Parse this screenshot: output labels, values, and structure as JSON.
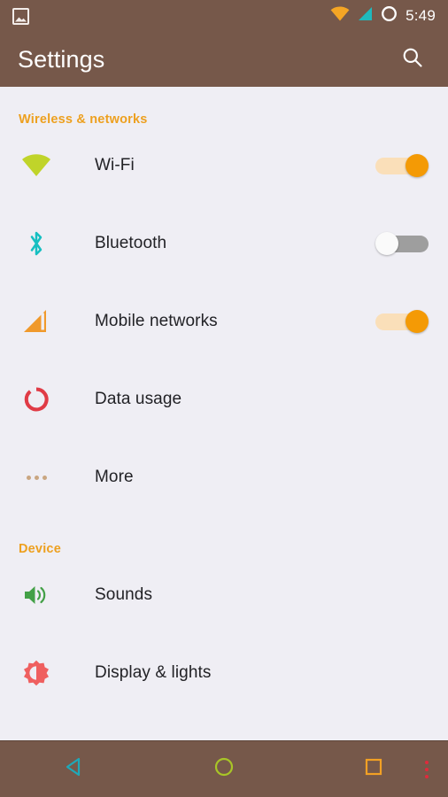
{
  "status_bar": {
    "left_icons": [
      {
        "name": "screenshot-icon",
        "label": "Screenshot"
      }
    ],
    "right_icons": [
      {
        "name": "wifi-signal-icon",
        "label": "Wi-Fi signal",
        "color": "#f5a524"
      },
      {
        "name": "cellular-signal-icon",
        "label": "Cellular signal",
        "color": "#1fb9bd"
      },
      {
        "name": "circle-status-icon",
        "label": "Do not disturb",
        "color": "#ffffff"
      }
    ],
    "clock": "5:49"
  },
  "app_bar": {
    "title": "Settings",
    "search_label": "Search",
    "background": "#76584a",
    "title_color": "#ffffff"
  },
  "colors": {
    "accent_header": "#eda01f",
    "page_background": "#efeef4",
    "chrome": "#76584a",
    "toggle_on_thumb": "#f49a05",
    "toggle_on_track": "#fadfb9",
    "toggle_off_track": "#9e9e9e",
    "toggle_off_thumb": "#fafafa"
  },
  "sections": [
    {
      "header": "Wireless & networks",
      "rows": [
        {
          "label": "Wi-Fi",
          "icon": "wifi-icon",
          "icon_color": "#c0d42a",
          "control": "toggle",
          "toggle_state": "on",
          "toggle_state_label": "On"
        },
        {
          "label": "Bluetooth",
          "icon": "bluetooth-icon",
          "icon_color": "#16bfc1",
          "control": "toggle",
          "toggle_state": "off",
          "toggle_state_label": "Off"
        },
        {
          "label": "Mobile networks",
          "icon": "cellular-bars-icon",
          "icon_color": "#f0992b",
          "control": "toggle",
          "toggle_state": "on",
          "toggle_state_label": "On"
        },
        {
          "label": "Data usage",
          "icon": "data-usage-icon",
          "icon_color": "#e03b46",
          "control": "none"
        },
        {
          "label": "More",
          "icon": "more-dots-icon",
          "icon_color": "#c9a681",
          "control": "none"
        }
      ]
    },
    {
      "header": "Device",
      "rows": [
        {
          "label": "Sounds",
          "icon": "volume-icon",
          "icon_color": "#43a047",
          "control": "none"
        },
        {
          "label": "Display & lights",
          "icon": "brightness-icon",
          "icon_color": "#ef5f5f",
          "control": "none"
        }
      ]
    }
  ],
  "nav_bar": {
    "buttons": [
      {
        "name": "nav-back-button",
        "label": "Back",
        "color": "#1fa8b8"
      },
      {
        "name": "nav-home-button",
        "label": "Home",
        "color": "#a8c527"
      },
      {
        "name": "nav-recents-button",
        "label": "Recents",
        "color": "#f2a024"
      },
      {
        "name": "nav-menu-button",
        "label": "Menu",
        "color": "#e02a3c"
      }
    ]
  }
}
